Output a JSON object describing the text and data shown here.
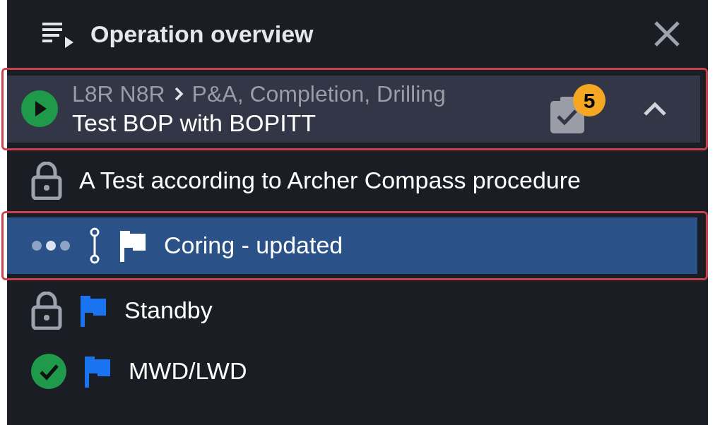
{
  "panel": {
    "title": "Operation overview"
  },
  "current_operation": {
    "path_start": "L8R N8R",
    "path_end": "P&A, Completion, Drilling",
    "title": "Test BOP with BOPITT",
    "badge": "5",
    "expanded": true,
    "highlighted": true
  },
  "steps": [
    {
      "label": "A Test according to Archer Compass procedure",
      "kind": "locked",
      "selected": false,
      "highlighted": false
    },
    {
      "label": "Coring - updated",
      "kind": "active",
      "flag": {
        "color": "#ffffff"
      },
      "selected": true,
      "highlighted": true
    },
    {
      "label": "Standby",
      "kind": "locked",
      "flag": {
        "color": "#1a73f0"
      },
      "selected": false,
      "highlighted": false
    },
    {
      "label": "MWD/LWD",
      "kind": "done",
      "flag": {
        "color": "#1a73f0"
      },
      "selected": false,
      "highlighted": false
    }
  ]
}
